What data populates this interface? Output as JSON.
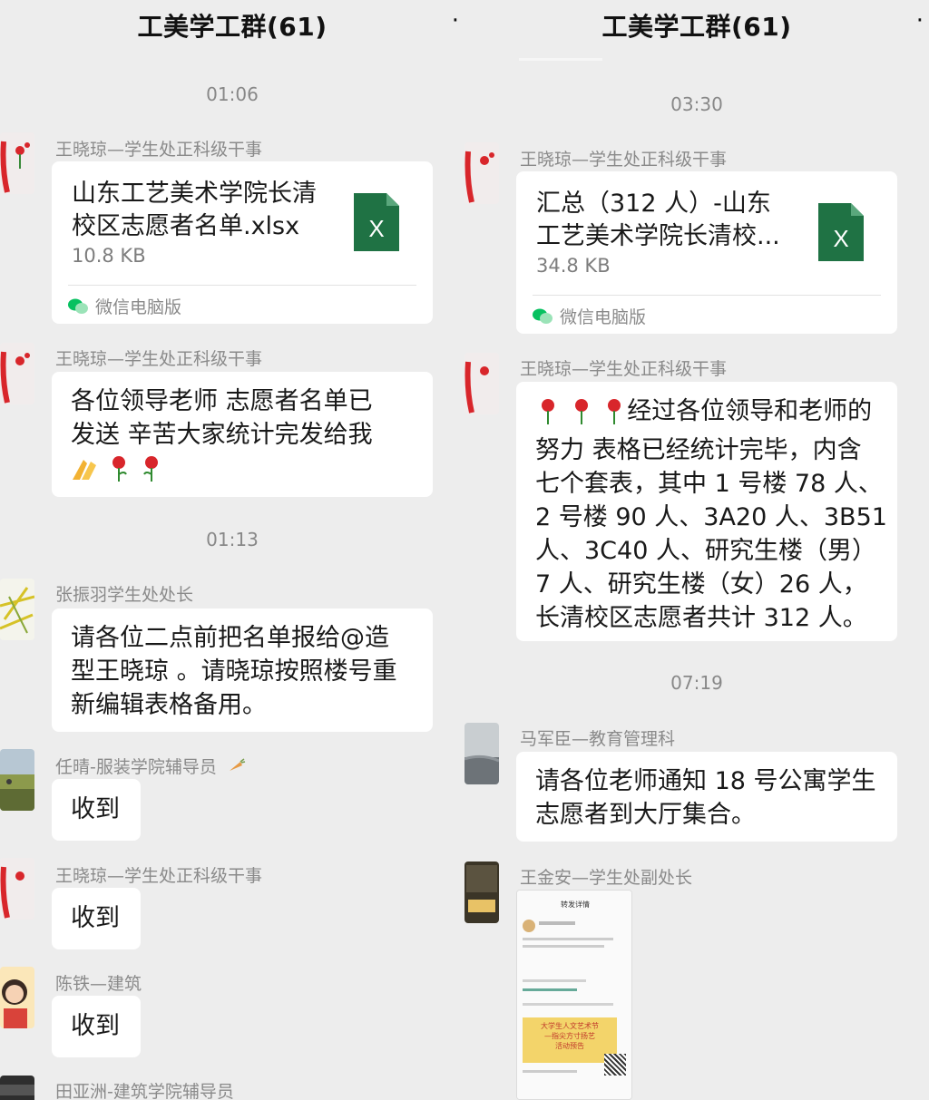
{
  "left": {
    "title": "工美学工群(61)",
    "menu": "·",
    "time1": "01:06",
    "msg1": {
      "sender": "王晓琼—学生处正科级干事",
      "file_line1": "山东工艺美术学院长清",
      "file_line2": "校区志愿者名单.xlsx",
      "file_size": "10.8 KB",
      "source": "微信电脑版"
    },
    "msg2": {
      "sender": "王晓琼—学生处正科级干事",
      "line1": "各位领导老师   志愿者名单已",
      "line2": "发送  辛苦大家统计完发给我"
    },
    "time2": "01:13",
    "msg3": {
      "sender": "张振羽学生处处长",
      "line1": "请各位二点前把名单报给@造",
      "line2": "型王晓琼  。请晓琼按照楼号重",
      "line3": "新编辑表格备用。"
    },
    "msg4": {
      "sender": "任晴-服装学院辅导员",
      "text": "收到"
    },
    "msg5": {
      "sender": "王晓琼—学生处正科级干事",
      "text": "收到"
    },
    "msg6": {
      "sender": "陈铁—建筑",
      "text": "收到"
    },
    "msg7": {
      "sender": "田亚洲-建筑学院辅导员"
    }
  },
  "right": {
    "title": "工美学工群(61)",
    "menu": "·",
    "time1": "03:30",
    "msg1": {
      "sender": "王晓琼—学生处正科级干事",
      "file_line1": "汇总（312 人）-山东",
      "file_line2": "工艺美术学院长清校...",
      "file_size": "34.8 KB",
      "source": "微信电脑版"
    },
    "msg2": {
      "sender": "王晓琼—学生处正科级干事",
      "line1": "经过各位领导和老师的",
      "line2": "努力  表格已经统计完毕，内含",
      "line3": "七个套表，其中 1 号楼 78 人、",
      "line4": "2 号楼 90 人、3A20 人、3B51",
      "line5": "人、3C40 人、研究生楼（男）",
      "line6": "7 人、研究生楼（女）26 人，",
      "line7": "长清校区志愿者共计 312 人。"
    },
    "time2": "07:19",
    "msg3": {
      "sender": "马军臣—教育管理科",
      "line1": "请各位老师通知 18 号公寓学生",
      "line2": "志愿者到大厅集合。"
    },
    "msg4": {
      "sender": "王金安—学生处副处长",
      "shot_header": "转发详情",
      "shot_banner1": "大学生人文艺术节",
      "shot_banner2": "—指尖方寸扬艺",
      "shot_banner3": "活动预告"
    }
  },
  "colors": {
    "background": "#ededed",
    "bubble": "#ffffff",
    "excel_green": "#1f7244",
    "wechat_green": "#07c160"
  }
}
